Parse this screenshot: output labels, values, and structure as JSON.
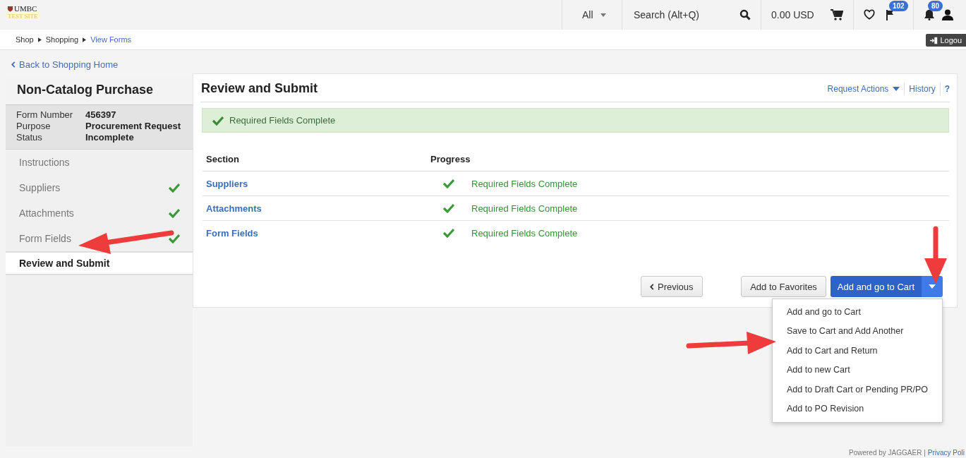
{
  "logo": {
    "name": "UMBC",
    "subtitle": "TEST SITE"
  },
  "header": {
    "search_scope": "All",
    "search": {
      "placeholder": "Search (Alt+Q)"
    },
    "cart_total": "0.00 USD",
    "flag_count": "102",
    "notification_count": "80"
  },
  "breadcrumb": [
    {
      "label": "Shop",
      "link": false
    },
    {
      "label": "Shopping",
      "link": false
    },
    {
      "label": "View Forms",
      "link": true
    }
  ],
  "logout": "Logou",
  "back_link": "Back to Shopping Home",
  "sidebar": {
    "title": "Non-Catalog Purchase",
    "info": [
      {
        "label": "Form Number",
        "value": "456397"
      },
      {
        "label": "Purpose",
        "value": "Procurement Request"
      },
      {
        "label": "Status",
        "value": "Incomplete"
      }
    ],
    "items": [
      {
        "label": "Instructions",
        "complete": false,
        "selected": false
      },
      {
        "label": "Suppliers",
        "complete": true,
        "selected": false
      },
      {
        "label": "Attachments",
        "complete": true,
        "selected": false
      },
      {
        "label": "Form Fields",
        "complete": true,
        "selected": false
      },
      {
        "label": "Review and Submit",
        "complete": false,
        "selected": true
      }
    ]
  },
  "panel": {
    "title": "Review and Submit",
    "actions": [
      "Request Actions",
      "History",
      "?"
    ],
    "alert": "Required Fields Complete",
    "table": {
      "columns": [
        "Section",
        "Progress"
      ],
      "rows": [
        {
          "section": "Suppliers",
          "complete": true,
          "progress": "Required Fields Complete"
        },
        {
          "section": "Attachments",
          "complete": true,
          "progress": "Required Fields Complete"
        },
        {
          "section": "Form Fields",
          "complete": true,
          "progress": "Required Fields Complete"
        }
      ]
    },
    "buttons": {
      "previous": "Previous",
      "favorites": "Add to Favorites",
      "primary": "Add and go to Cart"
    },
    "menu": {
      "expanded": true,
      "items": [
        "Add and go to Cart",
        "Save to Cart and Add Another",
        "Add to Cart and Return",
        "Add to new Cart",
        "Add to Draft Cart or Pending PR/PO",
        "Add to PO Revision"
      ]
    }
  },
  "footer": {
    "text": "Powered by JAGGAER |",
    "link": "Privacy Poli"
  }
}
